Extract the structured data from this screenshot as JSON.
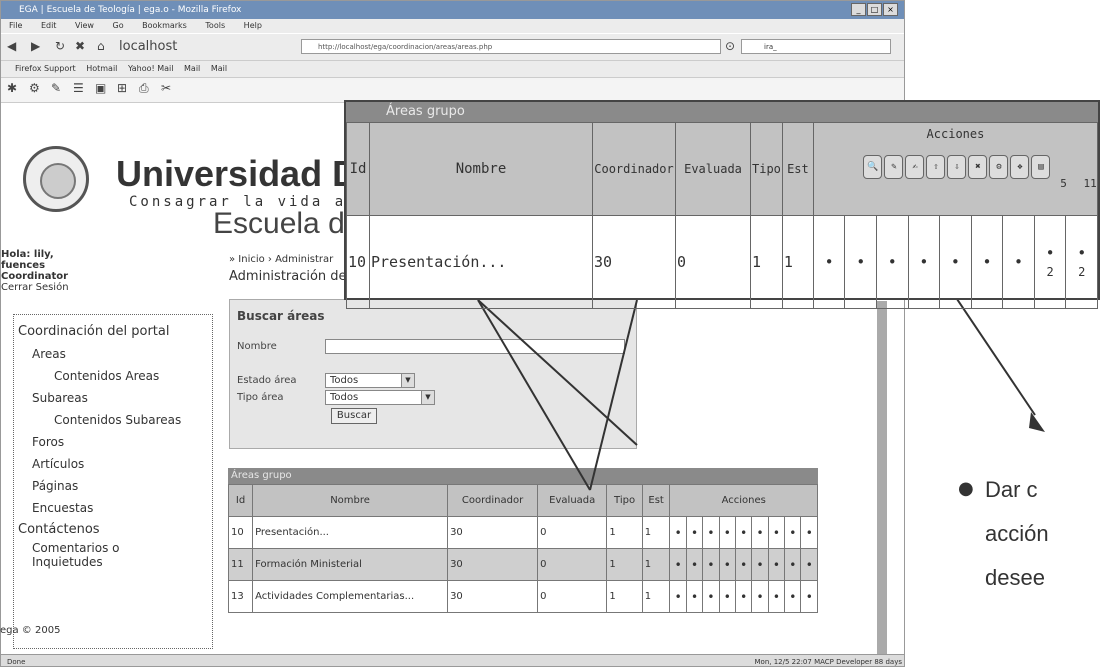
{
  "window": {
    "title": "EGA | Escuela de Teología | ega.o - Mozilla Firefox",
    "menu": [
      "File",
      "Edit",
      "View",
      "Go",
      "Bookmarks",
      "Tools",
      "Help"
    ],
    "url": "http://localhost/ega/coordinacion/areas/areas.php",
    "home_label": "localhost",
    "search_value": "ira_"
  },
  "bookmarks": [
    "Firefox Support",
    "Hotmail",
    "Yahoo! Mail",
    "Mail",
    "Mail"
  ],
  "header": {
    "university": "Universidad Do",
    "slogan": "Consagrar la vida a l",
    "school": "Escuela de"
  },
  "user": {
    "greeting": "Hola: lily,",
    "surname": "fuences",
    "role": "Coordinator",
    "logout": "Cerrar Sesión"
  },
  "sidebar": {
    "items": [
      {
        "label": "Coordinación del portal",
        "level": 0
      },
      {
        "label": "Areas",
        "level": 1
      },
      {
        "label": "Contenidos Areas",
        "level": 2
      },
      {
        "label": "Subareas",
        "level": 1
      },
      {
        "label": "Contenidos Subareas",
        "level": 2
      },
      {
        "label": "Foros",
        "level": 1
      },
      {
        "label": "Artículos",
        "level": 1
      },
      {
        "label": "Páginas",
        "level": 1
      },
      {
        "label": "Encuestas",
        "level": 1
      },
      {
        "label": "Contáctenos",
        "level": 0
      },
      {
        "label": "Comentarios o Inquietudes",
        "level": 1
      }
    ]
  },
  "footer_brand": "ega © 2005",
  "main": {
    "breadcrumb": "» Inicio › Administrar",
    "title": "Administración de",
    "search": {
      "title": "Buscar áreas",
      "name_label": "Nombre",
      "state_label": "Estado área",
      "type_label": "Tipo área",
      "state_value": "Todos",
      "type_value": "Todos",
      "button": "Buscar"
    }
  },
  "table": {
    "title": "Áreas grupo",
    "headers": [
      "Id",
      "Nombre",
      "Coordinador",
      "Evaluada",
      "Tipo",
      "Est"
    ],
    "actions_label": "Acciones",
    "rows": [
      {
        "id": "10",
        "name": "Presentación...",
        "coord": "30",
        "eval": "0",
        "tipo": "1",
        "est": "1"
      },
      {
        "id": "11",
        "name": "Formación Ministerial",
        "coord": "30",
        "eval": "0",
        "tipo": "1",
        "est": "1"
      },
      {
        "id": "13",
        "name": "Actividades Complementarias...",
        "coord": "30",
        "eval": "0",
        "tipo": "1",
        "est": "1"
      }
    ]
  },
  "magnified": {
    "title": "Áreas grupo",
    "headers": [
      "Id",
      "Nombre",
      "Coordinador",
      "Evaluada",
      "Tipo",
      "Est"
    ],
    "actions_label": "Acciones",
    "action_counts": [
      "5",
      "11"
    ],
    "row": {
      "id": "10",
      "name": "Presentación...",
      "coord": "30",
      "eval": "0",
      "tipo": "1",
      "est": "1",
      "counts": [
        "2",
        "2"
      ]
    }
  },
  "instruction": {
    "lines": [
      "Dar c",
      "acción",
      "desee"
    ]
  },
  "status": {
    "left": "Done",
    "right": "Mon, 12/5  22:07   MACP Developer  88 days"
  },
  "colors": {
    "title_bar": "#6f8fb8",
    "table_header": "#8a8a8a"
  }
}
